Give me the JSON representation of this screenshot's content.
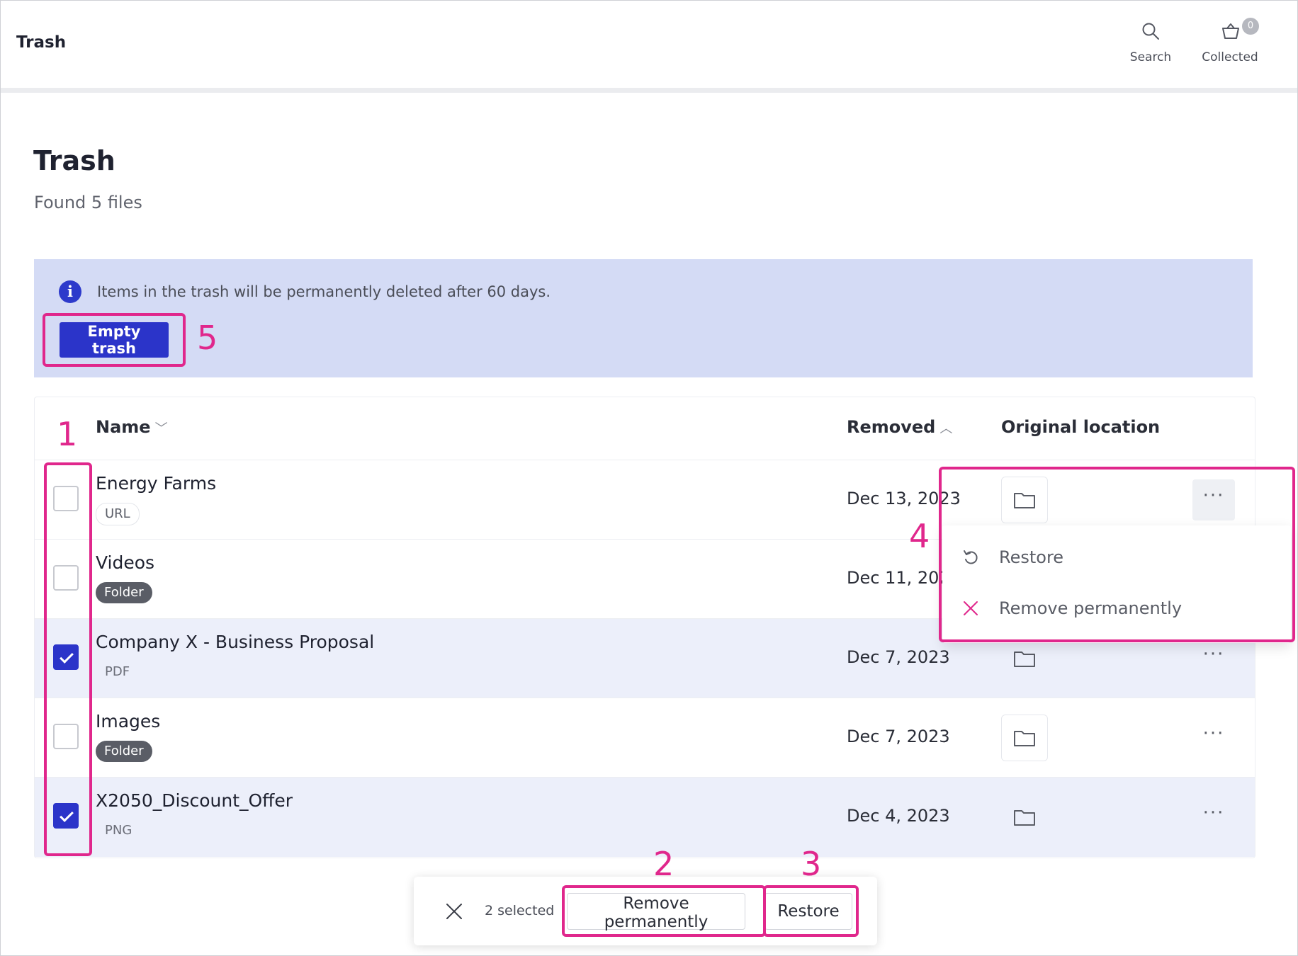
{
  "header": {
    "app_title": "Trash",
    "search_label": "Search",
    "collected_label": "Collected",
    "collected_count": "0"
  },
  "page": {
    "title": "Trash",
    "subtitle": "Found 5 files"
  },
  "banner": {
    "message": "Items in the trash will be permanently deleted after 60 days.",
    "empty_button": "Empty trash",
    "color": "#d4dbf5"
  },
  "table": {
    "columns": {
      "name": "Name",
      "removed": "Removed",
      "location": "Original location"
    },
    "rows": [
      {
        "name": "Energy Farms",
        "type": "URL",
        "removed": "Dec 13, 2023",
        "selected": false
      },
      {
        "name": "Videos",
        "type": "Folder",
        "removed": "Dec 11, 2023",
        "selected": false
      },
      {
        "name": "Company X - Business Proposal",
        "type": "PDF",
        "removed": "Dec 7, 2023",
        "selected": true
      },
      {
        "name": "Images",
        "type": "Folder",
        "removed": "Dec 7, 2023",
        "selected": false
      },
      {
        "name": "X2050_Discount_Offer",
        "type": "PNG",
        "removed": "Dec 4, 2023",
        "selected": true
      }
    ]
  },
  "context_menu": {
    "restore": "Restore",
    "remove": "Remove permanently"
  },
  "selection_bar": {
    "count": "2 selected",
    "remove_button": "Remove permanently",
    "restore_button": "Restore"
  },
  "callouts": [
    "1",
    "2",
    "3",
    "4",
    "5"
  ],
  "colors": {
    "accent": "#2b34c9",
    "highlight": "#e0278c",
    "danger": "#e0278c"
  }
}
